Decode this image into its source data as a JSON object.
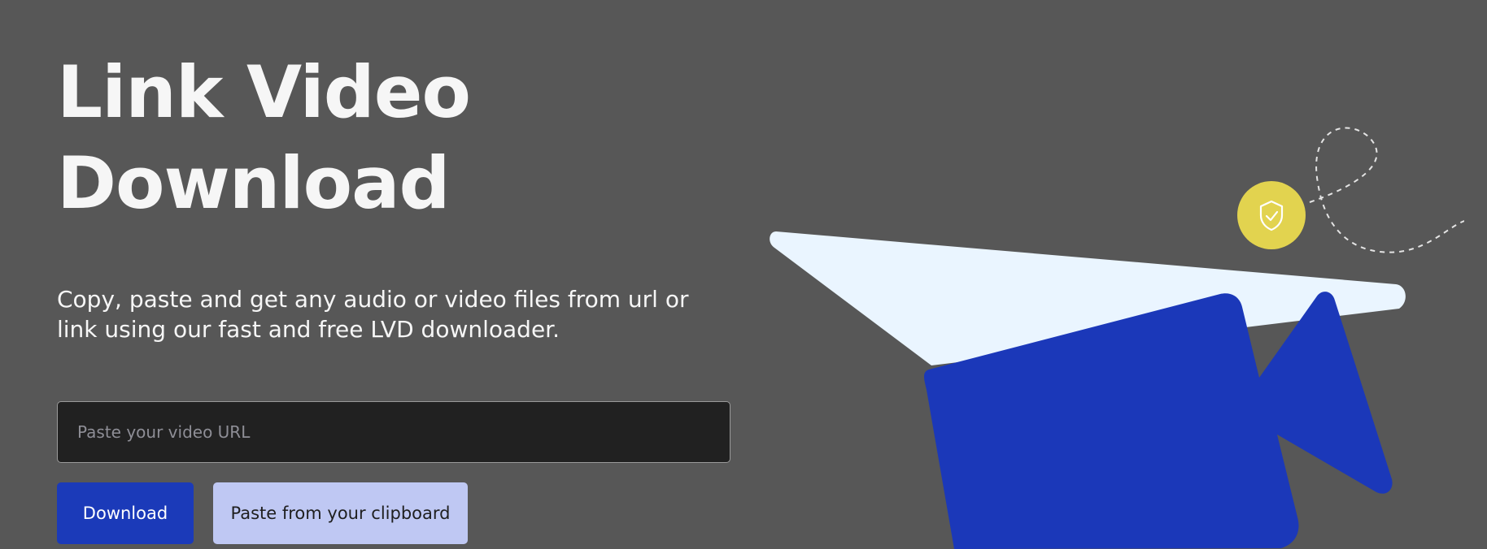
{
  "hero": {
    "title": "Link Video Download",
    "subtitle": "Copy, paste and get any audio or video files from url or link using our fast and free LVD downloader."
  },
  "url_input": {
    "placeholder": "Paste your video URL",
    "value": ""
  },
  "buttons": {
    "download_label": "Download",
    "paste_label": "Paste from your clipboard"
  },
  "illustration": {
    "icons": [
      "paper-plane-icon",
      "video-camera-icon",
      "shield-check-icon",
      "dashed-trail"
    ]
  },
  "colors": {
    "background": "#575757",
    "primary": "#1b3ab9",
    "secondary": "#bfc8f3",
    "input_background": "#212121",
    "plane": "#eaf5ff",
    "badge": "#e2d34f"
  }
}
